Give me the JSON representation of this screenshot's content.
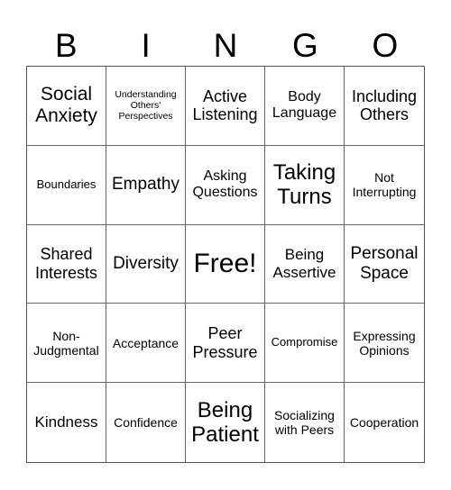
{
  "header": {
    "letters": [
      "B",
      "I",
      "N",
      "G",
      "O"
    ]
  },
  "cells": [
    "Social Anxiety",
    "Understanding Others' Perspectives",
    "Active Listening",
    "Body Language",
    "Including Others",
    "Boundaries",
    "Empathy",
    "Asking Questions",
    "Taking Turns",
    "Not Interrupting",
    "Shared Interests",
    "Diversity",
    "Free!",
    "Being Assertive",
    "Personal Space",
    "Non-Judgmental",
    "Acceptance",
    "Peer Pressure",
    "Compromise",
    "Expressing Opinions",
    "Kindness",
    "Confidence",
    "Being Patient",
    "Socializing with Peers",
    "Cooperation"
  ]
}
